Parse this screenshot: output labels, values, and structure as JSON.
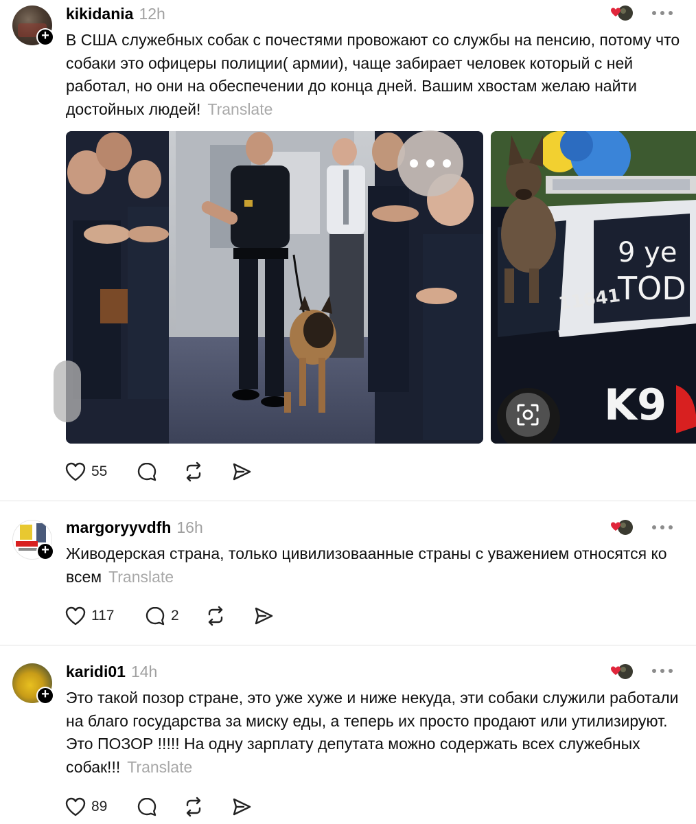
{
  "posts": [
    {
      "username": "kikidania",
      "time": "12h",
      "text": "В США служебных собак с почестями провожают со службы на пенсию, потому что собаки это офицеры полиции( армии), чаще забирает человек который с ней работал, но они на обеспечении до конца дней. Вашим хвостам желаю найти достойных людей!",
      "translate": "Translate",
      "likes": "55",
      "replies": "",
      "car_text_1": "9 ye",
      "car_text_2": "TOD",
      "car_number": "11641",
      "car_k9": "K9"
    },
    {
      "username": "margoryyvdfh",
      "time": "16h",
      "text": "Живодерская страна, только цивилизоваанные страны с уважением относятся ко всем",
      "translate": "Translate",
      "likes": "117",
      "replies": "2"
    },
    {
      "username": "karidi01",
      "time": "14h",
      "text": "Это такой позор стране, это уже хуже и ниже некуда, эти собаки служили работали на благо государства за миску еды, а теперь их просто продают или утилизируют. Это ПОЗОР !!!!! На одну зарплату депутата можно содержать всех служебных собак!!!",
      "translate": "Translate",
      "likes": "89",
      "replies": ""
    }
  ],
  "icons": {
    "like": "heart-icon",
    "reply": "comment-icon",
    "repost": "repost-icon",
    "share": "send-icon",
    "more": "more-dots-icon",
    "follow": "plus-icon",
    "lens": "visual-search-icon"
  },
  "colors": {
    "accent_red": "#e0263b",
    "muted": "#a0a0a0",
    "text": "#101010"
  }
}
